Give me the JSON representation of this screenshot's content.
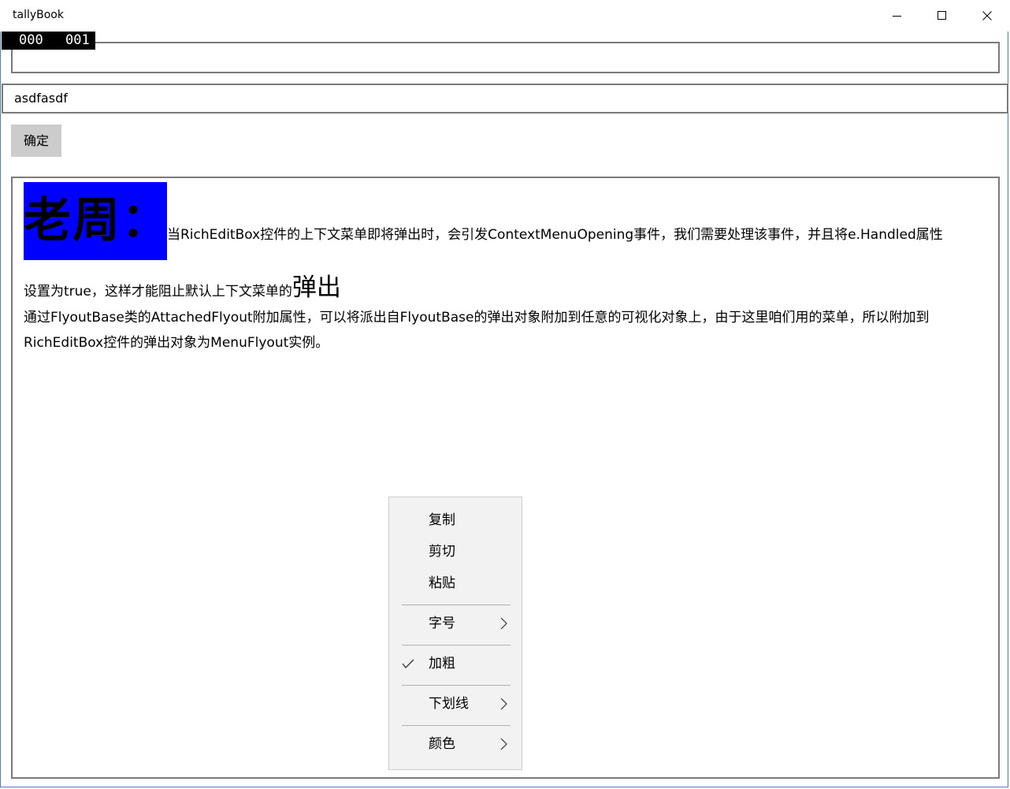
{
  "window": {
    "title": "tallyBook"
  },
  "counter": {
    "a": "000",
    "b": "001"
  },
  "input2": {
    "value": "asdfasdf"
  },
  "ok_button": {
    "label": "确定"
  },
  "colors": {
    "highlight": "#0000ff",
    "button_bg": "#cccccc",
    "menu_bg": "#f2f2f2"
  },
  "richtext": {
    "heading": "老周：",
    "line1": "当RichEditBox控件的上下文菜单即将弹出时，会引发ContextMenuOpening事件，我们需要处理该事件，并且将e.Handled属性",
    "line2_a": "设置为true，这样才能阻止默认上下文菜单的",
    "line2_big": "弹出",
    "line3": "通过FlyoutBase类的AttachedFlyout附加属性，可以将派出自FlyoutBase的弹出对象附加到任意的可视化对象上，由于这里咱们用的菜单，所以附加到",
    "line4": "RichEditBox控件的弹出对象为MenuFlyout实例。"
  },
  "context_menu": {
    "copy": "复制",
    "cut": "剪切",
    "paste": "粘贴",
    "font_size": "字号",
    "bold": "加粗",
    "bold_checked": true,
    "underline": "下划线",
    "color": "颜色"
  }
}
